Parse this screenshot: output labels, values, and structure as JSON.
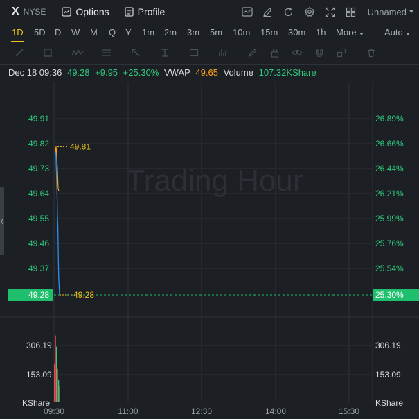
{
  "header": {
    "ticker": "X",
    "exchange": "NYSE",
    "options_label": "Options",
    "profile_label": "Profile",
    "layout_name": "Unnamed",
    "right_icons": [
      "indicator-chart-icon",
      "draw-pen-icon",
      "refresh-icon",
      "settings-gear-icon",
      "fullscreen-icon",
      "grid-layout-icon"
    ]
  },
  "periods": {
    "items": [
      "1D",
      "5D",
      "D",
      "W",
      "M",
      "Q",
      "Y",
      "1m",
      "2m",
      "3m",
      "5m",
      "10m",
      "15m",
      "30m",
      "1h"
    ],
    "more_label": "More",
    "auto_label": "Auto",
    "active": "1D"
  },
  "info": {
    "date": "Dec 18 09:36",
    "price": "49.28",
    "change": "+9.95",
    "change_pct": "+25.30%",
    "vwap_label": "VWAP",
    "vwap_value": "49.65",
    "volume_label": "Volume",
    "volume_value": "107.32KShare"
  },
  "chart_data": {
    "type": "line",
    "watermark": "Trading Hour",
    "price_axis_left": [
      "49.91",
      "49.82",
      "49.73",
      "49.64",
      "49.55",
      "49.46",
      "49.37",
      "49.28"
    ],
    "price_axis_right": [
      "26.89%",
      "26.66%",
      "26.44%",
      "26.21%",
      "25.99%",
      "25.76%",
      "25.54%",
      "25.30%"
    ],
    "current_price_tag": "49.28",
    "current_pct_tag": "25.30%",
    "high_marker": "49.81",
    "low_marker": "49.28",
    "volume_axis_left": [
      "306.19",
      "153.09",
      "KShare"
    ],
    "volume_axis_right": [
      "306.19",
      "153.09",
      "KShare"
    ],
    "x_ticks": [
      "09:30",
      "11:00",
      "12:30",
      "14:00",
      "15:30"
    ],
    "ylim": [
      49.28,
      49.91
    ],
    "price_series": {
      "name": "Price",
      "color": "#2f8fe8",
      "points": [
        [
          0,
          49.78
        ],
        [
          0.5,
          49.8
        ],
        [
          1,
          49.74
        ],
        [
          1.5,
          49.7
        ],
        [
          2,
          49.64
        ],
        [
          2.5,
          49.56
        ],
        [
          3,
          49.52
        ],
        [
          3.5,
          49.42
        ],
        [
          4,
          49.34
        ],
        [
          5,
          49.28
        ],
        [
          6,
          49.28
        ]
      ]
    },
    "vwap_series": {
      "name": "VWAP",
      "color": "#ff9f1a",
      "points": [
        [
          0,
          49.79
        ],
        [
          1,
          49.81
        ],
        [
          2,
          49.78
        ],
        [
          3,
          49.72
        ],
        [
          4,
          49.66
        ],
        [
          5,
          49.65
        ]
      ]
    },
    "volume_bars": {
      "unit": "KShare",
      "ylim": [
        0,
        306.19
      ],
      "values": [
        210,
        360,
        300,
        180,
        120,
        90
      ],
      "colors": [
        "#e24b4b",
        "#e24b4b",
        "#2fc87c",
        "#e24b4b",
        "#2fc87c",
        "#e24b4b"
      ]
    }
  }
}
